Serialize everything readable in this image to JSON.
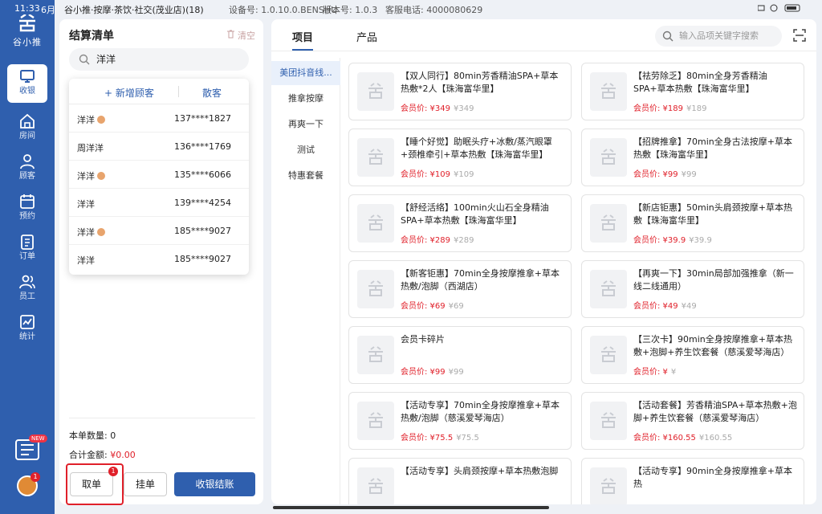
{
  "status": {
    "time": "11:33",
    "date": "6月",
    "store": "谷小推·按摩·茶饮·社交(茂业店)(18)",
    "device": "设备号: 1.0.10.0.BENSHU",
    "version": "版本号:  1.0.3",
    "phone": "客服电话:  4000080629"
  },
  "brand": {
    "logo_text": "谷小推"
  },
  "sidebar": {
    "items": [
      {
        "label": "收银",
        "icon": "monitor-icon"
      },
      {
        "label": "房间",
        "icon": "home-icon"
      },
      {
        "label": "顾客",
        "icon": "user-icon"
      },
      {
        "label": "预约",
        "icon": "calendar-icon"
      },
      {
        "label": "订单",
        "icon": "clipboard-icon"
      },
      {
        "label": "员工",
        "icon": "staff-icon"
      },
      {
        "label": "统计",
        "icon": "chart-icon"
      }
    ],
    "new_badge": "NEW",
    "avatar_badge": "1"
  },
  "cart": {
    "title": "结算清单",
    "clear": "清空",
    "search_value": "洋洋",
    "add_customer": "+ 新增顾客",
    "walkin": "散客",
    "customers": [
      {
        "name": "洋洋",
        "phone": "137****1827",
        "badge": true
      },
      {
        "name": "周洋洋",
        "phone": "136****1769",
        "badge": false
      },
      {
        "name": "洋洋",
        "phone": "135****6066",
        "badge": true
      },
      {
        "name": "洋洋",
        "phone": "139****4254",
        "badge": false
      },
      {
        "name": "洋洋",
        "phone": "185****9027",
        "badge": true
      },
      {
        "name": "洋洋",
        "phone": "185****9027",
        "badge": false
      }
    ],
    "count_label": "本单数量:",
    "count_value": "0",
    "total_label": "合计金额:",
    "total_value": "¥0.00",
    "take_button": "取单",
    "take_badge": "1",
    "hang_button": "挂单",
    "pay_button": "收银结账"
  },
  "main": {
    "tabs": [
      "项目",
      "产品"
    ],
    "search_placeholder": "输入品项关键字搜索",
    "categories": [
      "美团抖音线...",
      "推拿按摩",
      "再爽一下",
      "测试",
      "特惠套餐"
    ],
    "products": [
      {
        "name": "【双人同行】80min芳香精油SPA+草本热敷*2人【珠海富华里】",
        "price": "会员价: ¥349",
        "orig": "¥349"
      },
      {
        "name": "【祛劳除乏】80min全身芳香精油SPA+草本热敷【珠海富华里】",
        "price": "会员价: ¥189",
        "orig": "¥189"
      },
      {
        "name": "【睡个好觉】助眠头疗+冰敷/蒸汽眼罩+颈椎牵引+草本热敷【珠海富华里】",
        "price": "会员价: ¥109",
        "orig": "¥109"
      },
      {
        "name": "【招牌推拿】70min全身古法按摩+草本热敷【珠海富华里】",
        "price": "会员价: ¥99",
        "orig": "¥99"
      },
      {
        "name": "【舒经活络】100min火山石全身精油SPA+草本热敷【珠海富华里】",
        "price": "会员价: ¥289",
        "orig": "¥289"
      },
      {
        "name": "【新店钜惠】50min头肩颈按摩+草本热敷【珠海富华里】",
        "price": "会员价: ¥39.9",
        "orig": "¥39.9"
      },
      {
        "name": "【新客钜惠】70min全身按摩推拿+草本热敷/泡脚（西湖店）",
        "price": "会员价: ¥69",
        "orig": "¥69"
      },
      {
        "name": "【再爽一下】30min局部加强推拿（新一线二线通用）",
        "price": "会员价: ¥49",
        "orig": "¥49"
      },
      {
        "name": "会员卡碎片",
        "price": "会员价: ¥99",
        "orig": "¥99"
      },
      {
        "name": "【三次卡】90min全身按摩推拿+草本热敷+泡脚+养生饮套餐（慈溪爱琴海店）",
        "price": "会员价: ¥",
        "orig": "¥"
      },
      {
        "name": "【活动专享】70min全身按摩推拿+草本热敷/泡脚（慈溪爱琴海店）",
        "price": "会员价: ¥75.5",
        "orig": "¥75.5"
      },
      {
        "name": "【活动套餐】芳香精油SPA+草本热敷+泡脚+养生饮套餐（慈溪爱琴海店）",
        "price": "会员价: ¥160.55",
        "orig": "¥160.55"
      },
      {
        "name": "【活动专享】头肩颈按摩+草本热敷泡脚",
        "price": "",
        "orig": ""
      },
      {
        "name": "【活动专享】90min全身按摩推拿+草本热",
        "price": "",
        "orig": ""
      }
    ]
  },
  "colors": {
    "primary": "#2f5fae",
    "accent_red": "#e0202a"
  }
}
